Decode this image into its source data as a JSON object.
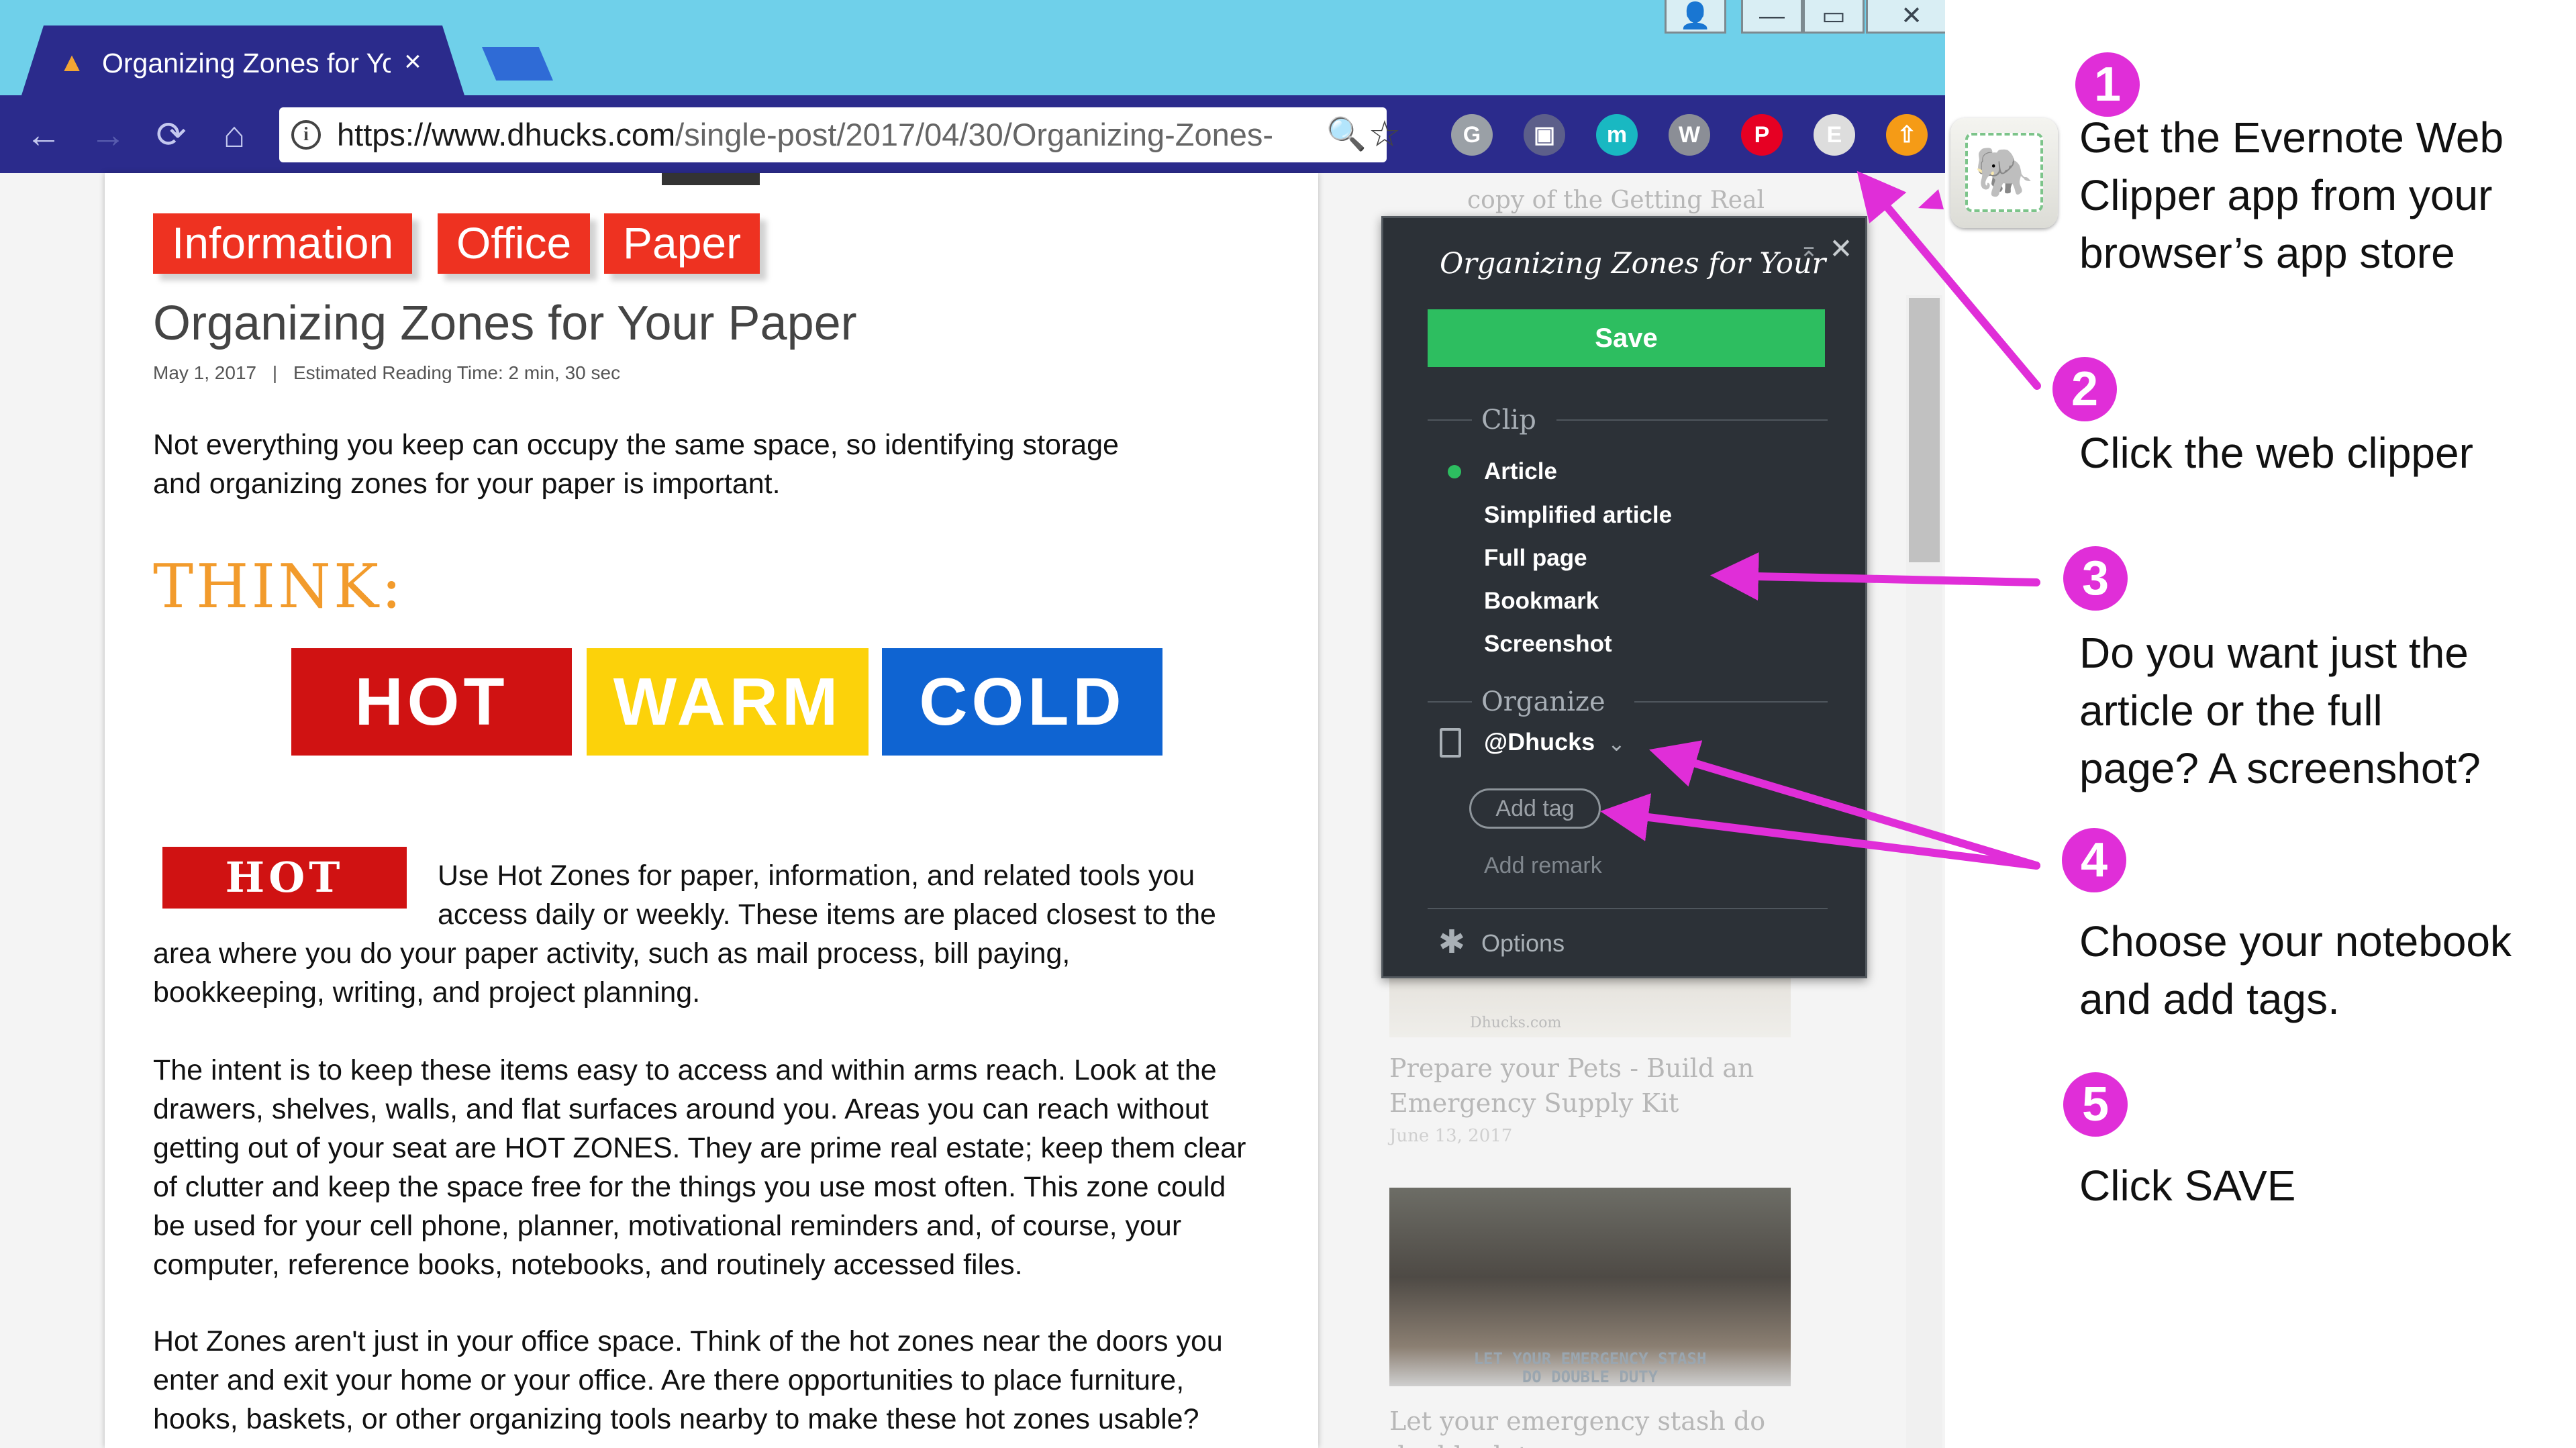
{
  "browser": {
    "tab_title": "Organizing Zones for You",
    "tab_close": "×",
    "url_domain": "https://www.dhucks.com",
    "url_path": "/single-post/2017/04/30/Organizing-Zones-",
    "window_buttons": {
      "user": "👤",
      "minimize": "—",
      "restore": "▭",
      "close": "✕"
    },
    "nav": {
      "back": "←",
      "forward": "→",
      "reload": "⟳",
      "home": "⌂"
    },
    "zoom_glyph": "🔍",
    "bookmark_glyph": "☆",
    "extensions": [
      {
        "name": "grammarly-icon",
        "glyph": "G",
        "color": "#9aa0a6"
      },
      {
        "name": "screen-capture-icon",
        "glyph": "▣",
        "color": "#5c5f8a"
      },
      {
        "name": "m-extension-icon",
        "glyph": "m",
        "color": "#19b8c2"
      },
      {
        "name": "w-extension-icon",
        "glyph": "W",
        "color": "#8b8e96"
      },
      {
        "name": "pinterest-icon",
        "glyph": "P",
        "color": "#e60023"
      },
      {
        "name": "evernote-icon",
        "glyph": "E",
        "color": "#dddddd"
      },
      {
        "name": "upload-icon",
        "glyph": "⇧",
        "color": "#f59b16"
      }
    ]
  },
  "article": {
    "categories": [
      "Information",
      "Office",
      "Paper"
    ],
    "title": "Organizing Zones for Your Paper",
    "date": "May 1, 2017",
    "separator": "|",
    "reading_time": "Estimated Reading Time: 2 min, 30 sec",
    "intro_lines": [
      " Not everything you keep can occupy the same space, so identifying storage",
      "and organizing zones for your paper is important."
    ],
    "think": "THINK:",
    "zones": [
      {
        "label": "HOT",
        "color": "#d01212"
      },
      {
        "label": "WARM",
        "color": "#fcd20a"
      },
      {
        "label": "COLD",
        "color": "#0f64d2"
      }
    ],
    "hot_badge": "HOT",
    "hot_lines": [
      "Use Hot Zones for paper, information, and related tools you",
      "access daily or weekly. These items are placed closest to the",
      "area where you do your paper activity, such as mail process, bill paying,",
      "bookkeeping, writing, and project planning."
    ],
    "intent_lines": [
      "The intent is to keep these items easy to access and within arms reach. Look at the",
      "drawers, shelves, walls, and flat surfaces around you. Areas you can reach without",
      "getting out of your seat are HOT ZONES. They are prime real estate; keep them clear",
      "of clutter and keep the space free for the things you use most often. This zone could",
      "be used for your cell phone, planner, motivational reminders and, of course, your",
      "computer, reference books, notebooks, and routinely accessed files."
    ],
    "hotzones_lines": [
      "Hot Zones aren't just in your office space. Think of the hot zones near the doors you",
      "enter and exit your home or your office. Are there opportunities to place furniture,",
      "hooks, baskets, or other organizing tools nearby to make these hot zones usable?"
    ]
  },
  "sidebar": {
    "top_snippet": "copy of the Getting Real",
    "thumb1_watermark": "Dhucks.com",
    "post1_title_lines": [
      "Prepare your Pets - Build an",
      "Emergency Supply Kit"
    ],
    "post1_date": "June 13, 2017",
    "thumb2_caption_lines": [
      "LET YOUR EMERGENCY STASH",
      "DO DOUBLE DUTY"
    ],
    "post2_title_lines": [
      "Let your emergency stash do",
      "double duty"
    ]
  },
  "clipper": {
    "title": "Organizing Zones for Your",
    "minimize_glyph": "⌅",
    "close_glyph": "✕",
    "save_label": "Save",
    "clip_label": "Clip",
    "clip_options": [
      "Article",
      "Simplified article",
      "Full page",
      "Bookmark",
      "Screenshot"
    ],
    "selected_option": "Article",
    "organize_label": "Organize",
    "notebook": "@Dhucks",
    "notebook_chevron": "⌄",
    "add_tag": "Add tag",
    "add_remark": "Add remark",
    "gear_glyph": "✱",
    "options_label": "Options"
  },
  "instructions": {
    "app_icon_glyph": "🐘",
    "accent_color": "#e02ed8",
    "steps": [
      {
        "num": "1",
        "lines": [
          "Get the Evernote Web",
          "Clipper app from your",
          "browser’s app store"
        ]
      },
      {
        "num": "2",
        "lines": [
          "Click the web clipper"
        ]
      },
      {
        "num": "3",
        "lines": [
          "Do you want just the",
          "article or the full",
          "page? A screenshot?"
        ]
      },
      {
        "num": "4",
        "lines": [
          "Choose your notebook",
          "and add tags."
        ]
      },
      {
        "num": "5",
        "lines": [
          "Click SAVE"
        ]
      }
    ]
  }
}
